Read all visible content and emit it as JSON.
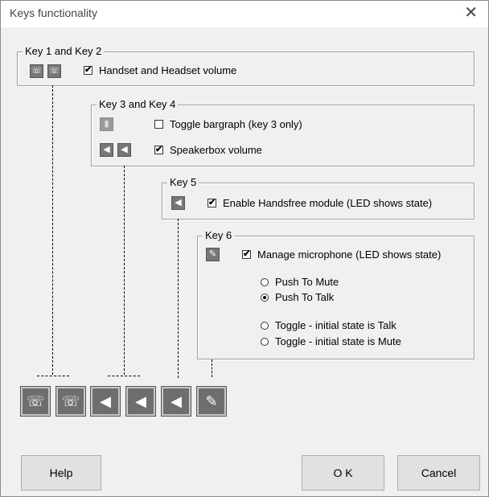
{
  "window": {
    "title": "Keys functionality",
    "close_symbol": "✕"
  },
  "group1": {
    "legend": "Key 1 and Key 2",
    "check_label": "Handset and Headset volume",
    "checked": true
  },
  "group2": {
    "legend": "Key 3 and Key 4",
    "bargraph_label": "Toggle bargraph (key 3 only)",
    "bargraph_checked": false,
    "speaker_label": "Speakerbox volume",
    "speaker_checked": true
  },
  "group3": {
    "legend": "Key 5",
    "check_label": "Enable Handsfree module (LED shows state)",
    "checked": true
  },
  "group4": {
    "legend": "Key 6",
    "check_label": "Manage microphone (LED shows state)",
    "checked": true,
    "radios": [
      {
        "label": "Push To Mute",
        "selected": false
      },
      {
        "label": "Push To Talk",
        "selected": true
      },
      {
        "label": "Toggle - initial state is Talk",
        "selected": false
      },
      {
        "label": "Toggle - initial state is Mute",
        "selected": false
      }
    ]
  },
  "keys": [
    {
      "icon": "handset-icon",
      "glyph": "☏"
    },
    {
      "icon": "headset-volume-icon",
      "glyph": "☏"
    },
    {
      "icon": "speaker-volume-down-icon",
      "glyph": "◀"
    },
    {
      "icon": "speaker-volume-up-icon",
      "glyph": "◀"
    },
    {
      "icon": "handsfree-speaker-icon",
      "glyph": "◀"
    },
    {
      "icon": "microphone-icon",
      "glyph": "✎"
    }
  ],
  "buttons": {
    "help": "Help",
    "ok": "O K",
    "cancel": "Cancel"
  }
}
